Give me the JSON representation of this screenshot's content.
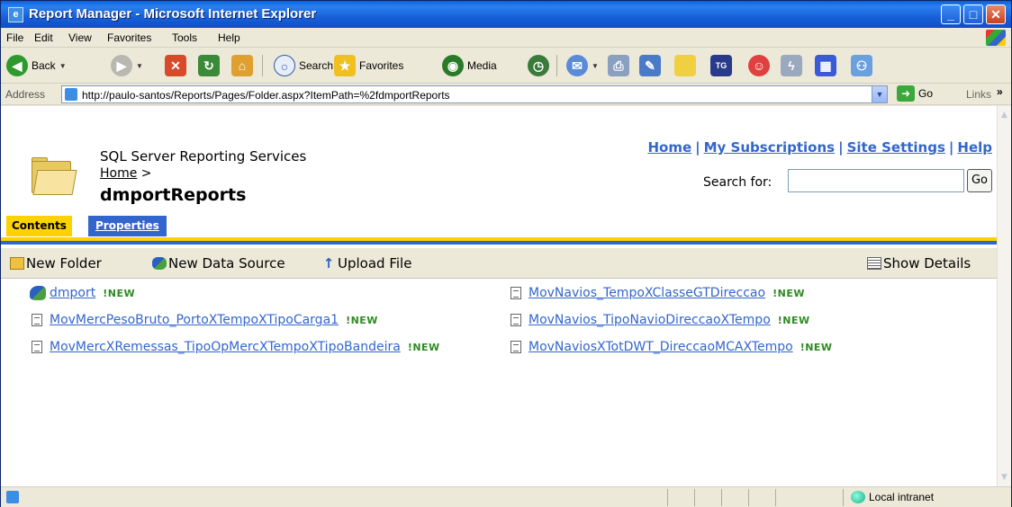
{
  "window": {
    "title": "Report Manager - Microsoft Internet Explorer"
  },
  "menu": [
    "File",
    "Edit",
    "View",
    "Favorites",
    "Tools",
    "Help"
  ],
  "toolbar": {
    "back": "Back",
    "search": "Search",
    "favorites": "Favorites",
    "media": "Media"
  },
  "address": {
    "label": "Address",
    "url": "http://paulo-santos/Reports/Pages/Folder.aspx?ItemPath=%2fdmportReports",
    "go": "Go",
    "links": "Links",
    "links_more": "»"
  },
  "header": {
    "product": "SQL Server Reporting Services",
    "breadcrumb_home": "Home",
    "breadcrumb_sep": ">",
    "title": "dmportReports",
    "links": [
      "Home",
      "My Subscriptions",
      "Site Settings",
      "Help"
    ],
    "link_separator": "|",
    "search_label": "Search for:",
    "search_value": "",
    "search_go": "Go"
  },
  "tabs": {
    "contents": "Contents",
    "properties": "Properties"
  },
  "actions": {
    "new_folder": "New Folder",
    "new_data_source": "New Data Source",
    "upload_file": "Upload File",
    "show_details": "Show Details"
  },
  "items": {
    "left": [
      {
        "name": "dmport",
        "badge": "!NEW",
        "type": "datasource"
      },
      {
        "name": "MovMercPesoBruto_PortoXTempoXTipoCarga1",
        "badge": "!NEW",
        "type": "report"
      },
      {
        "name": "MovMercXRemessas_TipoOpMercXTempoXTipoBandeira",
        "badge": "!NEW",
        "type": "report"
      }
    ],
    "right": [
      {
        "name": "MovNavios_TempoXClasseGTDireccao",
        "badge": "!NEW",
        "type": "report"
      },
      {
        "name": "MovNavios_TipoNavioDireccaoXTempo",
        "badge": "!NEW",
        "type": "report"
      },
      {
        "name": "MovNaviosXTotDWT_DireccaoMCAXTempo",
        "badge": "!NEW",
        "type": "report"
      }
    ]
  },
  "status": {
    "zone": "Local intranet"
  },
  "colors": {
    "link": "#3366cc",
    "tab_active": "#fcd200",
    "tab_inactive": "#3366cc",
    "new_badge": "#2e8b22"
  }
}
